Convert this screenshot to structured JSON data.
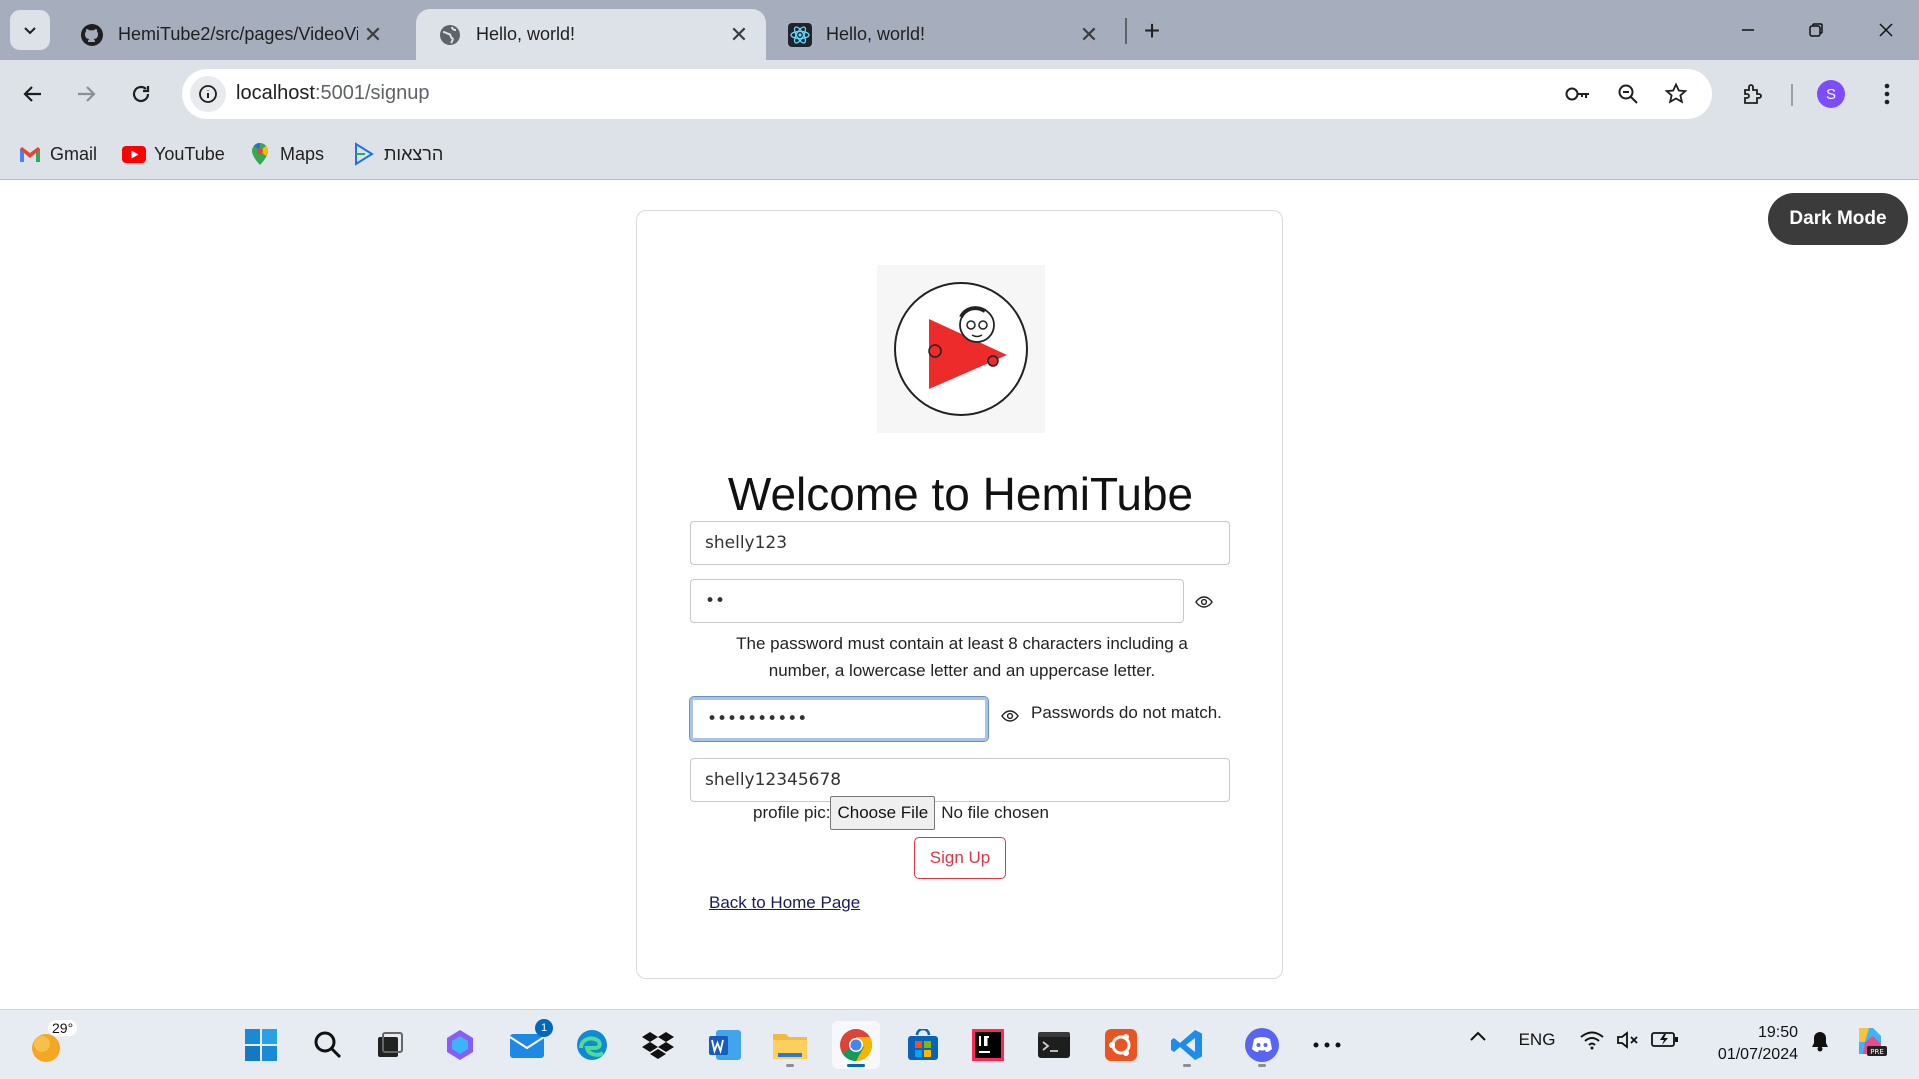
{
  "browser": {
    "tabs": [
      {
        "title": "HemiTube2/src/pages/VideoVie",
        "icon": "github-icon",
        "active": false
      },
      {
        "title": "Hello, world!",
        "icon": "globe-icon",
        "active": true
      },
      {
        "title": "Hello, world!",
        "icon": "react-icon",
        "active": false
      }
    ],
    "url_host": "localhost",
    "url_path": ":5001/signup",
    "profile_initial": "S",
    "bookmarks": [
      {
        "label": "Gmail",
        "icon": "gmail-icon"
      },
      {
        "label": "YouTube",
        "icon": "youtube-icon"
      },
      {
        "label": "Maps",
        "icon": "maps-icon"
      },
      {
        "label": "הרצאות",
        "icon": "bookmark-site-icon"
      }
    ]
  },
  "page": {
    "dark_mode_label": "Dark Mode",
    "title": "Welcome to HemiTube",
    "username_value": "shelly123",
    "password_value": "••",
    "password_hint": "The password must contain at least 8 characters including a number, a lowercase letter and an uppercase letter.",
    "confirm_value": "••••••••••",
    "mismatch_text": "Passwords do not match.",
    "display_name_value": "shelly12345678",
    "profile_pic_label": "profile pic:",
    "choose_file_label": "Choose File",
    "no_file_text": "No file chosen",
    "signup_label": "Sign Up",
    "back_link_label": "Back to Home Page"
  },
  "taskbar": {
    "weather_temp": "29°",
    "mail_badge": "1",
    "language": "ENG",
    "time": "19:50",
    "date": "01/07/2024"
  },
  "colors": {
    "tabstrip": "#a6adbd",
    "toolbar": "#dde1e8",
    "danger": "#dc3545",
    "dark_button": "#3b3b3b",
    "taskbar": "#e7ecf2",
    "accent": "#0067c0"
  }
}
